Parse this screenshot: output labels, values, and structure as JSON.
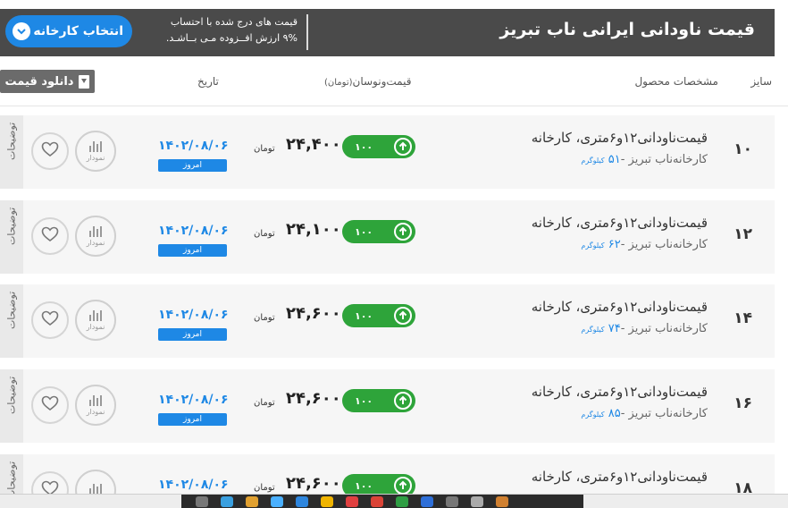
{
  "header": {
    "title": "قیمت ناودانی ایرانی ناب تبریز",
    "note_line1": "قیمت های درج شده با احتساب",
    "note_line2": "۹% ارزش افــزوده مـی بــاشـد.",
    "factory_button": "انتخاب کارخانه"
  },
  "columns": {
    "size": "سایز",
    "specs": "مشخصات محصول",
    "price_change": "قیمت‌ونوسان",
    "price_unit": "(تومان)",
    "date": "تاریخ",
    "download": "دانلود قیمت"
  },
  "rows": [
    {
      "size": "۱۰",
      "name": "قیمت‌ناودانی۱۲و۶متری، کارخانه",
      "factory": "کارخانه‌ناب تبریز -",
      "weight": "۵۱",
      "weight_unit": "کیلوگرم",
      "change": "۱۰۰",
      "price": "۲۴,۴۰۰",
      "currency": "تومان",
      "date": "۱۴۰۲/۰۸/۰۶",
      "today": "امروز",
      "chart_label": "نمودار",
      "side_label": "توضیحات"
    },
    {
      "size": "۱۲",
      "name": "قیمت‌ناودانی۱۲و۶متری، کارخانه",
      "factory": "کارخانه‌ناب تبریز -",
      "weight": "۶۲",
      "weight_unit": "کیلوگرم",
      "change": "۱۰۰",
      "price": "۲۴,۱۰۰",
      "currency": "تومان",
      "date": "۱۴۰۲/۰۸/۰۶",
      "today": "امروز",
      "chart_label": "نمودار",
      "side_label": "توضیحات"
    },
    {
      "size": "۱۴",
      "name": "قیمت‌ناودانی۱۲و۶متری، کارخانه",
      "factory": "کارخانه‌ناب تبریز -",
      "weight": "۷۴",
      "weight_unit": "کیلوگرم",
      "change": "۱۰۰",
      "price": "۲۴,۶۰۰",
      "currency": "تومان",
      "date": "۱۴۰۲/۰۸/۰۶",
      "today": "امروز",
      "chart_label": "نمودار",
      "side_label": "توضیحات"
    },
    {
      "size": "۱۶",
      "name": "قیمت‌ناودانی۱۲و۶متری، کارخانه",
      "factory": "کارخانه‌ناب تبریز -",
      "weight": "۸۵",
      "weight_unit": "کیلوگرم",
      "change": "۱۰۰",
      "price": "۲۴,۶۰۰",
      "currency": "تومان",
      "date": "۱۴۰۲/۰۸/۰۶",
      "today": "امروز",
      "chart_label": "نمودار",
      "side_label": "توضیحات"
    },
    {
      "size": "۱۸",
      "name": "قیمت‌ناودانی۱۲و۶متری، کارخانه",
      "factory": "",
      "weight": "",
      "weight_unit": "",
      "change": "۱۰۰",
      "price": "۲۴,۶۰۰",
      "currency": "تومان",
      "date": "۱۴۰۲/۰۸/۰۶",
      "today": "",
      "chart_label": "",
      "side_label": "توضیحات"
    }
  ],
  "colors": {
    "accent": "#1e88e5",
    "header_bg": "#4a4a4a",
    "up": "#2ea43a"
  }
}
